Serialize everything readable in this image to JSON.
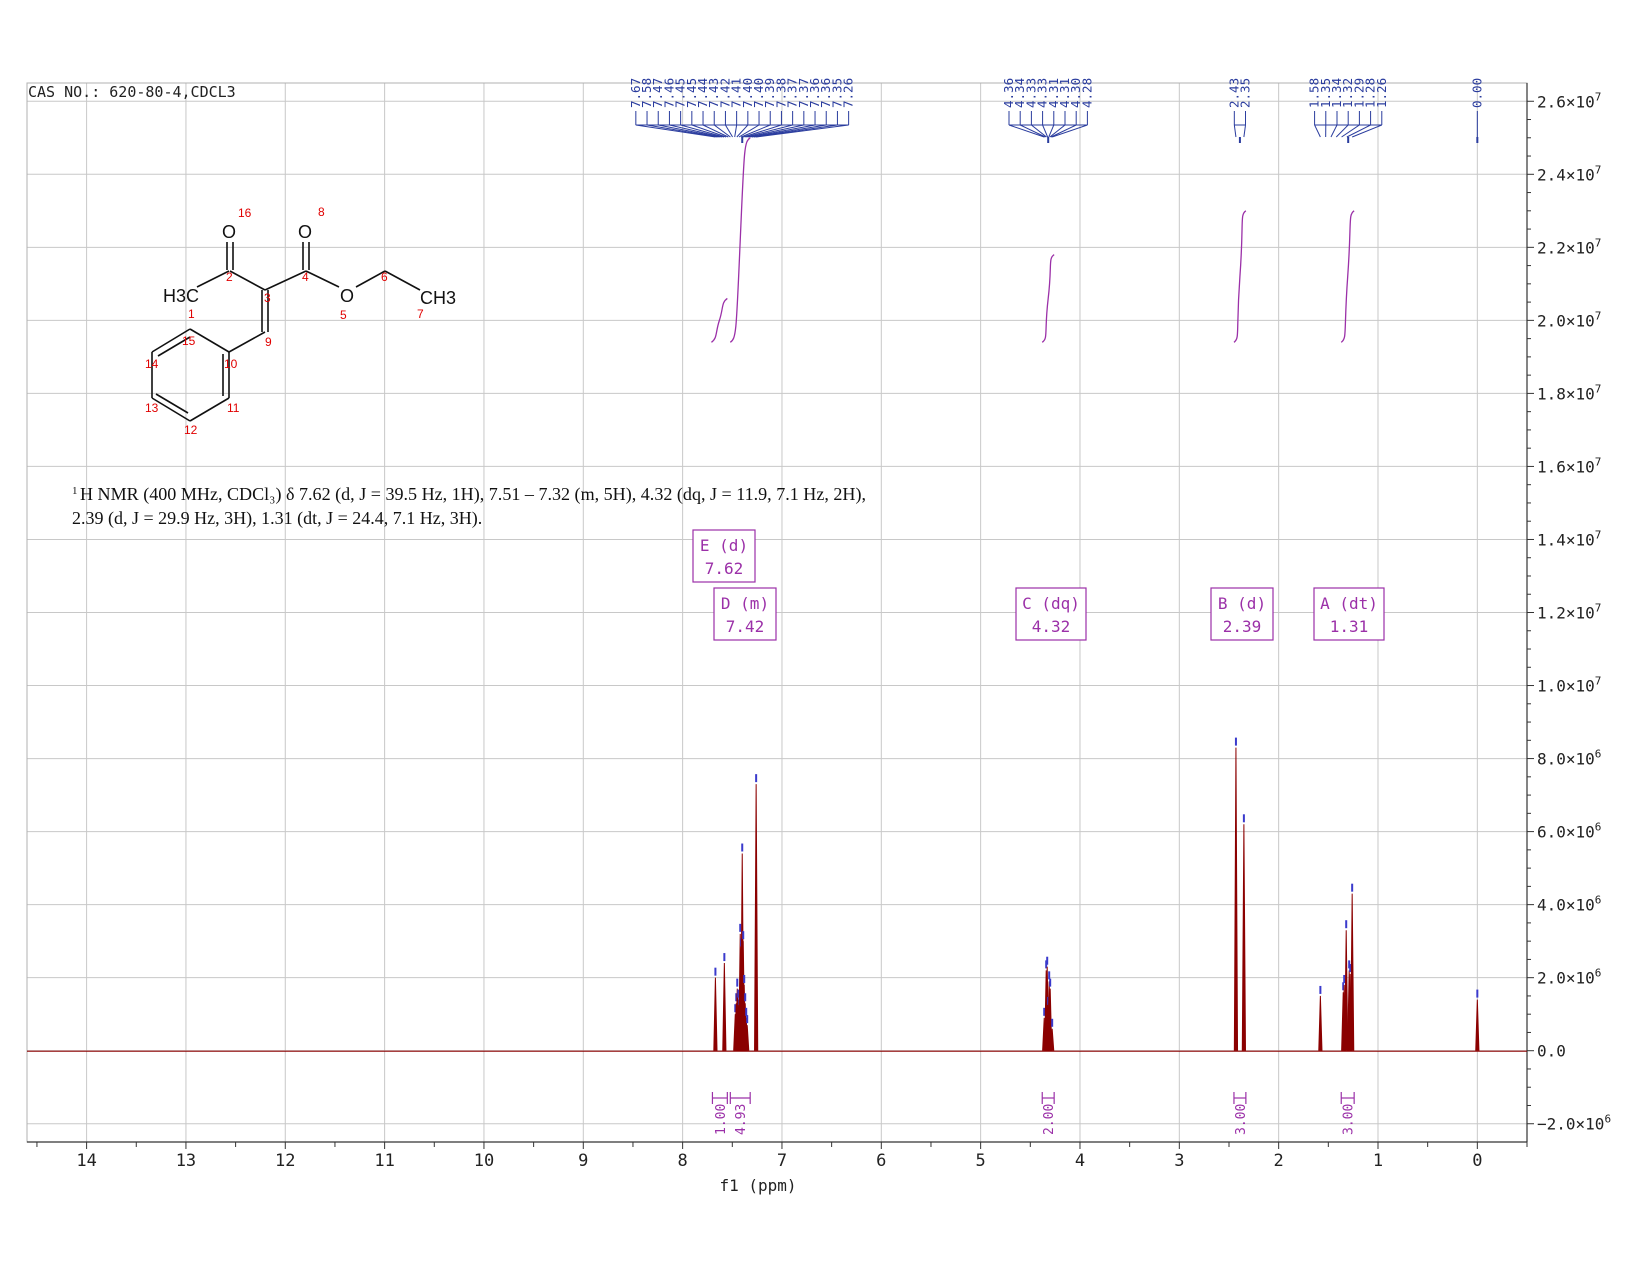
{
  "chart_data": {
    "type": "line",
    "header": "CAS NO.: 620-80-4,CDCL3",
    "xlabel": "f1 (ppm)",
    "xlim": [
      14.6,
      -0.5
    ],
    "ylim": [
      -2500000.0,
      26500000.0
    ],
    "x_ticks": [
      "14",
      "13",
      "12",
      "11",
      "10",
      "9",
      "8",
      "7",
      "6",
      "5",
      "4",
      "3",
      "2",
      "1",
      "0"
    ],
    "y_ticks": [
      {
        "value": 26000000,
        "mant": "2.6×10",
        "exp": "7"
      },
      {
        "value": 24000000,
        "mant": "2.4×10",
        "exp": "7"
      },
      {
        "value": 22000000,
        "mant": "2.2×10",
        "exp": "7"
      },
      {
        "value": 20000000,
        "mant": "2.0×10",
        "exp": "7"
      },
      {
        "value": 18000000,
        "mant": "1.8×10",
        "exp": "7"
      },
      {
        "value": 16000000,
        "mant": "1.6×10",
        "exp": "7"
      },
      {
        "value": 14000000,
        "mant": "1.4×10",
        "exp": "7"
      },
      {
        "value": 12000000,
        "mant": "1.2×10",
        "exp": "7"
      },
      {
        "value": 10000000,
        "mant": "1.0×10",
        "exp": "7"
      },
      {
        "value": 8000000,
        "mant": "8.0×10",
        "exp": "6"
      },
      {
        "value": 6000000,
        "mant": "6.0×10",
        "exp": "6"
      },
      {
        "value": 4000000,
        "mant": "4.0×10",
        "exp": "6"
      },
      {
        "value": 2000000,
        "mant": "2.0×10",
        "exp": "6"
      },
      {
        "value": 0,
        "mant": "0.0",
        "exp": ""
      },
      {
        "value": -2000000,
        "mant": "−2.0×10",
        "exp": "6"
      }
    ],
    "peaks": [
      {
        "ppm": 7.67,
        "h": 2000000
      },
      {
        "ppm": 7.58,
        "h": 2400000
      },
      {
        "ppm": 7.47,
        "h": 1000000
      },
      {
        "ppm": 7.46,
        "h": 1300000
      },
      {
        "ppm": 7.45,
        "h": 1700000
      },
      {
        "ppm": 7.44,
        "h": 1400000
      },
      {
        "ppm": 7.43,
        "h": 1200000
      },
      {
        "ppm": 7.42,
        "h": 3200000
      },
      {
        "ppm": 7.41,
        "h": 2800000
      },
      {
        "ppm": 7.4,
        "h": 5400000
      },
      {
        "ppm": 7.39,
        "h": 3000000
      },
      {
        "ppm": 7.38,
        "h": 1800000
      },
      {
        "ppm": 7.37,
        "h": 1300000
      },
      {
        "ppm": 7.36,
        "h": 900000
      },
      {
        "ppm": 7.35,
        "h": 700000
      },
      {
        "ppm": 7.26,
        "h": 7300000
      },
      {
        "ppm": 4.36,
        "h": 900000
      },
      {
        "ppm": 4.34,
        "h": 2200000
      },
      {
        "ppm": 4.33,
        "h": 2300000
      },
      {
        "ppm": 4.32,
        "h": 1200000
      },
      {
        "ppm": 4.31,
        "h": 1900000
      },
      {
        "ppm": 4.3,
        "h": 1700000
      },
      {
        "ppm": 4.28,
        "h": 600000
      },
      {
        "ppm": 2.43,
        "h": 8300000
      },
      {
        "ppm": 2.35,
        "h": 6200000
      },
      {
        "ppm": 1.58,
        "h": 1500000
      },
      {
        "ppm": 1.35,
        "h": 1600000
      },
      {
        "ppm": 1.34,
        "h": 1800000
      },
      {
        "ppm": 1.32,
        "h": 3300000
      },
      {
        "ppm": 1.29,
        "h": 2200000
      },
      {
        "ppm": 1.28,
        "h": 2100000
      },
      {
        "ppm": 1.26,
        "h": 4300000
      },
      {
        "ppm": 0.0,
        "h": 1400000
      }
    ],
    "peak_label_groups": [
      {
        "labels": [
          "7.67",
          "7.58",
          "7.47",
          "7.46",
          "7.45",
          "7.45",
          "7.44",
          "7.43",
          "7.42",
          "7.41",
          "7.40",
          "7.40",
          "7.39",
          "7.38",
          "7.37",
          "7.37",
          "7.36",
          "7.36",
          "7.35",
          "7.26"
        ],
        "from": 7.67,
        "to": 7.26,
        "center": 7.4
      },
      {
        "labels": [
          "4.36",
          "4.34",
          "4.33",
          "4.33",
          "4.31",
          "4.31",
          "4.30",
          "4.28"
        ],
        "from": 4.36,
        "to": 4.28,
        "center": 4.32
      },
      {
        "labels": [
          "2.43",
          "2.35"
        ],
        "from": 2.43,
        "to": 2.35,
        "center": 2.39
      },
      {
        "labels": [
          "1.58",
          "1.35",
          "1.34",
          "1.32",
          "1.29",
          "1.28",
          "1.26"
        ],
        "from": 1.58,
        "to": 1.26,
        "center": 1.3
      },
      {
        "labels": [
          "0.00"
        ],
        "from": 0.0,
        "to": 0.0,
        "center": 0.0
      }
    ],
    "multiplets": [
      {
        "letter": "E",
        "type": "d",
        "shift": "7.62"
      },
      {
        "letter": "D",
        "type": "m",
        "shift": "7.42"
      },
      {
        "letter": "C",
        "type": "dq",
        "shift": "4.32"
      },
      {
        "letter": "B",
        "type": "d",
        "shift": "2.39"
      },
      {
        "letter": "A",
        "type": "dt",
        "shift": "1.31"
      }
    ],
    "integrals": [
      {
        "from": 7.7,
        "to": 7.55,
        "value": "1.00"
      },
      {
        "from": 7.52,
        "to": 7.32,
        "value": "4.93"
      },
      {
        "from": 4.38,
        "to": 4.26,
        "value": "2.00"
      },
      {
        "from": 2.45,
        "to": 2.33,
        "value": "3.00"
      },
      {
        "from": 1.37,
        "to": 1.24,
        "value": "3.00"
      }
    ],
    "description_line1": "H NMR (400 MHz, CDCl₃) δ 7.62 (d, J = 39.5 Hz, 1H), 7.51 – 7.32 (m, 5H), 4.32 (dq, J = 11.9, 7.1 Hz, 2H),",
    "description_line2": "2.39 (d, J = 29.9 Hz, 3H), 1.31 (dt, J = 24.4, 7.1 Hz, 3H).",
    "description_sup": "1",
    "structure": {
      "atoms": [
        "O",
        "O",
        "H3C",
        "CH3",
        "O"
      ],
      "atom_numbers": [
        "1",
        "2",
        "3",
        "4",
        "5",
        "6",
        "7",
        "8",
        "9",
        "10",
        "11",
        "12",
        "13",
        "14",
        "15",
        "16"
      ]
    },
    "colors": {
      "spectrum": "#8B0000",
      "peak_labels": "#2a3c9e",
      "integral": "#9b30a8",
      "grid": "#c8c8c8",
      "atom_numbers": "#e00000"
    }
  }
}
